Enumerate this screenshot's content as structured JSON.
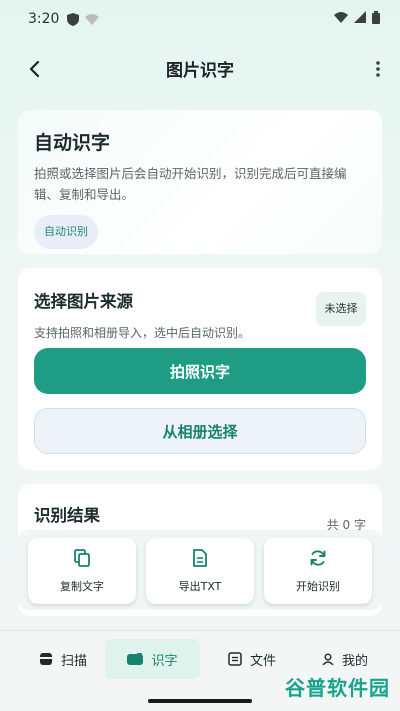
{
  "status_bar": {
    "time": "3:20"
  },
  "app_bar": {
    "title": "图片识字"
  },
  "intro": {
    "title": "自动识字",
    "description": "拍照或选择图片后会自动开始识别，识别完成后可直接编辑、复制和导出。",
    "chip": "自动识别"
  },
  "source": {
    "title": "选择图片来源",
    "subtitle": "支持拍照和相册导入，选中后自动识别。",
    "status": "未选择",
    "camera_button": "拍照识字",
    "album_button": "从相册选择"
  },
  "result": {
    "title": "识别结果",
    "count": "共 0 字"
  },
  "actions": [
    {
      "label": "复制文字",
      "icon": "copy-icon"
    },
    {
      "label": "导出TXT",
      "icon": "document-icon"
    },
    {
      "label": "开始识别",
      "icon": "refresh-icon"
    }
  ],
  "bottom_nav": [
    {
      "label": "扫描",
      "icon": "scan-icon"
    },
    {
      "label": "识字",
      "icon": "text-recognition-icon",
      "active": true
    },
    {
      "label": "文件",
      "icon": "file-icon"
    },
    {
      "label": "我的",
      "icon": "person-icon"
    }
  ],
  "watermark": "谷普软件园",
  "colors": {
    "accent": "#1f9c84",
    "accent_text": "#17836f"
  }
}
